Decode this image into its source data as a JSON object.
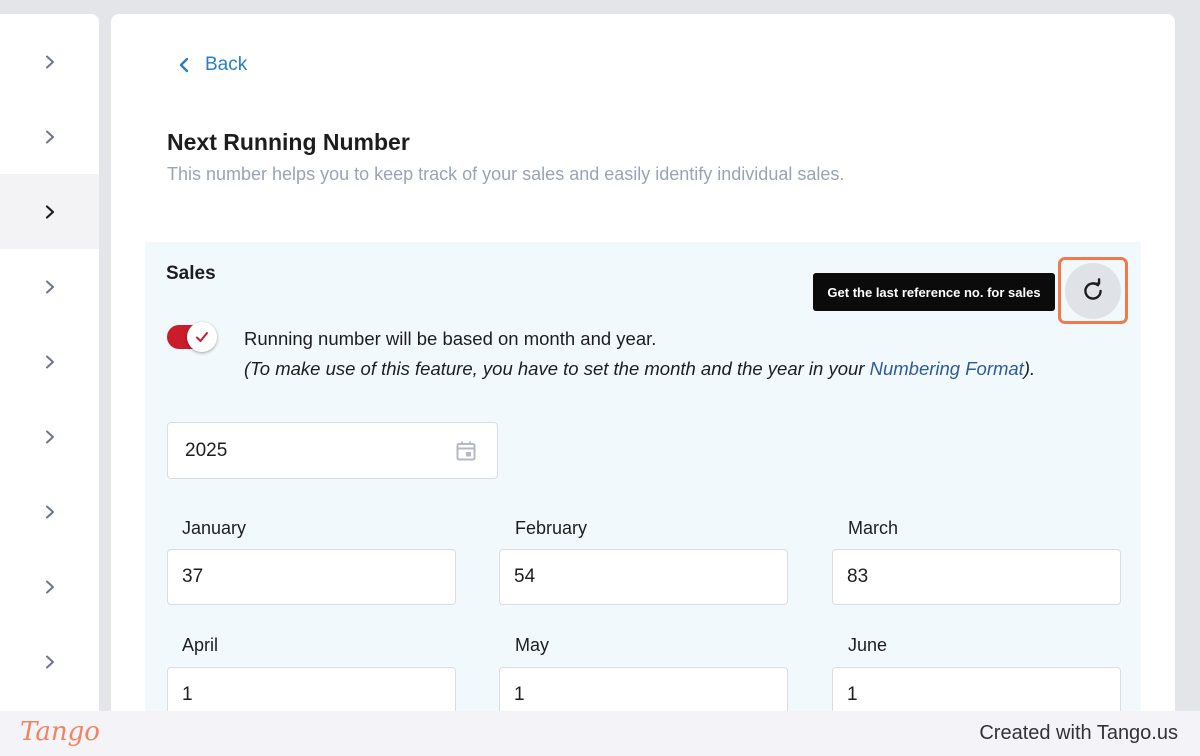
{
  "header": {
    "back_label": "Back",
    "title": "Next Running Number",
    "subtitle": "This number helps you to keep track of your sales and easily identify individual sales."
  },
  "sidebar": {
    "items": [
      {
        "icon": "chevron-right-icon",
        "active": false
      },
      {
        "icon": "chevron-right-icon",
        "active": false
      },
      {
        "icon": "chevron-right-icon",
        "active": true
      },
      {
        "icon": "chevron-right-icon",
        "active": false
      },
      {
        "icon": "chevron-right-icon",
        "active": false
      },
      {
        "icon": "chevron-right-icon",
        "active": false
      },
      {
        "icon": "chevron-right-icon",
        "active": false
      },
      {
        "icon": "chevron-right-icon",
        "active": false
      },
      {
        "icon": "chevron-right-icon",
        "active": false
      }
    ]
  },
  "sales": {
    "label": "Sales",
    "tooltip": "Get the last reference no. for sales",
    "refresh_icon": "refresh-icon",
    "toggle_on": true,
    "toggle_text": "Running number will be based on month and year.",
    "note_prefix": "(To make use of this feature, you have to set the month and the year in your ",
    "note_link": "Numbering Format",
    "note_suffix": ").",
    "year": "2025",
    "months": [
      {
        "label": "January",
        "value": "37"
      },
      {
        "label": "February",
        "value": "54"
      },
      {
        "label": "March",
        "value": "83"
      },
      {
        "label": "April",
        "value": "1"
      },
      {
        "label": "May",
        "value": "1"
      },
      {
        "label": "June",
        "value": "1"
      }
    ]
  },
  "footer": {
    "logo": "Tango",
    "created": "Created with Tango.us"
  },
  "colors": {
    "accent_link": "#2a7fc1",
    "toggle": "#c91d2c",
    "highlight": "#ef7b4d",
    "panel_bg": "#f2f9fd"
  }
}
